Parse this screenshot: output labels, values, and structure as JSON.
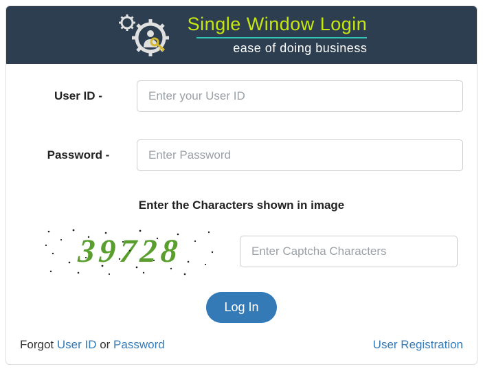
{
  "header": {
    "title": "Single Window Login",
    "subtitle": "ease of doing business"
  },
  "form": {
    "user_id_label": "User ID -",
    "user_id_placeholder": "Enter your User ID",
    "user_id_value": "",
    "password_label": "Password -",
    "password_placeholder": "Enter Password",
    "password_value": ""
  },
  "captcha": {
    "heading": "Enter the Characters shown in image",
    "code": "39728",
    "placeholder": "Enter Captcha Characters",
    "value": ""
  },
  "actions": {
    "login_label": "Log In"
  },
  "footer": {
    "forgot_prefix": "Forgot ",
    "user_id_link": "User ID",
    "or_text": " or ",
    "password_link": "Password",
    "register_link": "User Registration"
  }
}
